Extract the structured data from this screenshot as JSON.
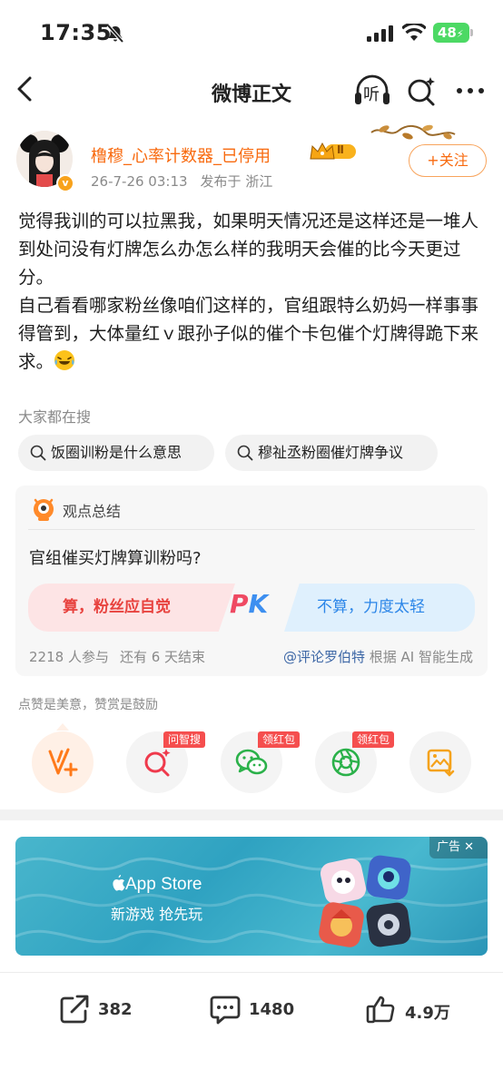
{
  "status_bar": {
    "time": "17:35",
    "battery": "48"
  },
  "nav": {
    "title": "微博正文",
    "listen_label": "听"
  },
  "author": {
    "name": "橹穆_心率计数器_已停用",
    "level": "Ⅱ",
    "date": "26-7-26 03:13",
    "location": "发布于 浙江",
    "follow_label": "+关注"
  },
  "post": {
    "text": "觉得我训的可以拉黑我，如果明天情况还是这样还是一堆人到处问没有灯牌怎么办怎么样的我明天会催的比今天更过分。\n自己看看哪家粉丝像咱们这样的，官组跟特么奶妈一样事事得管到，大体量红ｖ跟孙子似的催个卡包催个灯牌得跪下来求。"
  },
  "search": {
    "label": "大家都在搜",
    "chips": [
      "饭圈训粉是什么意思",
      "穆祉丞粉圈催灯牌争议"
    ]
  },
  "summary": {
    "title": "观点总结",
    "question": "官组催买灯牌算训粉吗?",
    "option_left": "算，粉丝应自觉",
    "option_right": "不算，力度太轻",
    "pk_p": "P",
    "pk_k": "K",
    "participants": "2218 人参与",
    "remaining": "还有 6 天结束",
    "credit_user": "@评论罗伯特",
    "credit_suffix": "根据 AI 智能生成"
  },
  "like_hint": "点赞是美意，赞赏是鼓励",
  "actions": {
    "tag_search": "问智搜",
    "tag_wechat": "领红包",
    "tag_moments": "领红包"
  },
  "ad": {
    "store": "App Store",
    "slogan": "新游戏 抢先玩",
    "badge": "广告 ✕"
  },
  "toolbar": {
    "share_count": "382",
    "comment_count": "1480",
    "like_count": "4.9万"
  },
  "colors": {
    "accent": "#f86a0f",
    "pk_red": "#e8433f",
    "pk_blue": "#2c86e8",
    "tag_red": "#f54e4e"
  }
}
